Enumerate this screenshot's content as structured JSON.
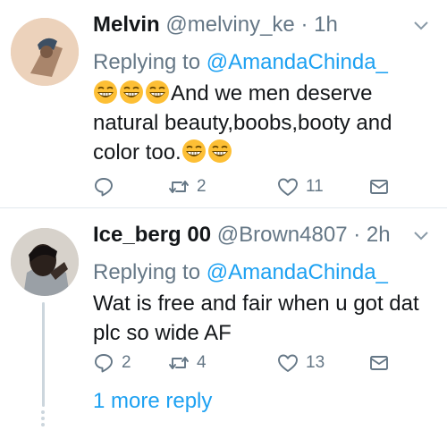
{
  "tweets": [
    {
      "name": "Melvin",
      "handle": "@melviny_ke",
      "separator": "·",
      "time": "1h",
      "replying_prefix": "Replying to ",
      "replying_to": "@AmandaChinda_",
      "emoji_icon": "grinning-squinting-face-icon",
      "text_line1": "And we men deserve",
      "text_line2": "natural beauty,boobs,booty and",
      "text_line3": "color too.",
      "reply_count": "",
      "retweet_count": "2",
      "like_count": "11"
    },
    {
      "name": "Ice_berg 00",
      "handle": "@Brown4807",
      "separator": "·",
      "time": "2h",
      "replying_prefix": "Replying to ",
      "replying_to": "@AmandaChinda_",
      "text_line1": "Wat is free and fair when u got dat",
      "text_line2": "plc so wide AF",
      "reply_count": "2",
      "retweet_count": "4",
      "like_count": "13",
      "more_replies": "1 more reply"
    }
  ],
  "colors": {
    "link": "#1da1f2",
    "muted": "#657786",
    "text": "#14171a",
    "divider": "#e1e8ed",
    "emoji": "#fdbf35"
  }
}
